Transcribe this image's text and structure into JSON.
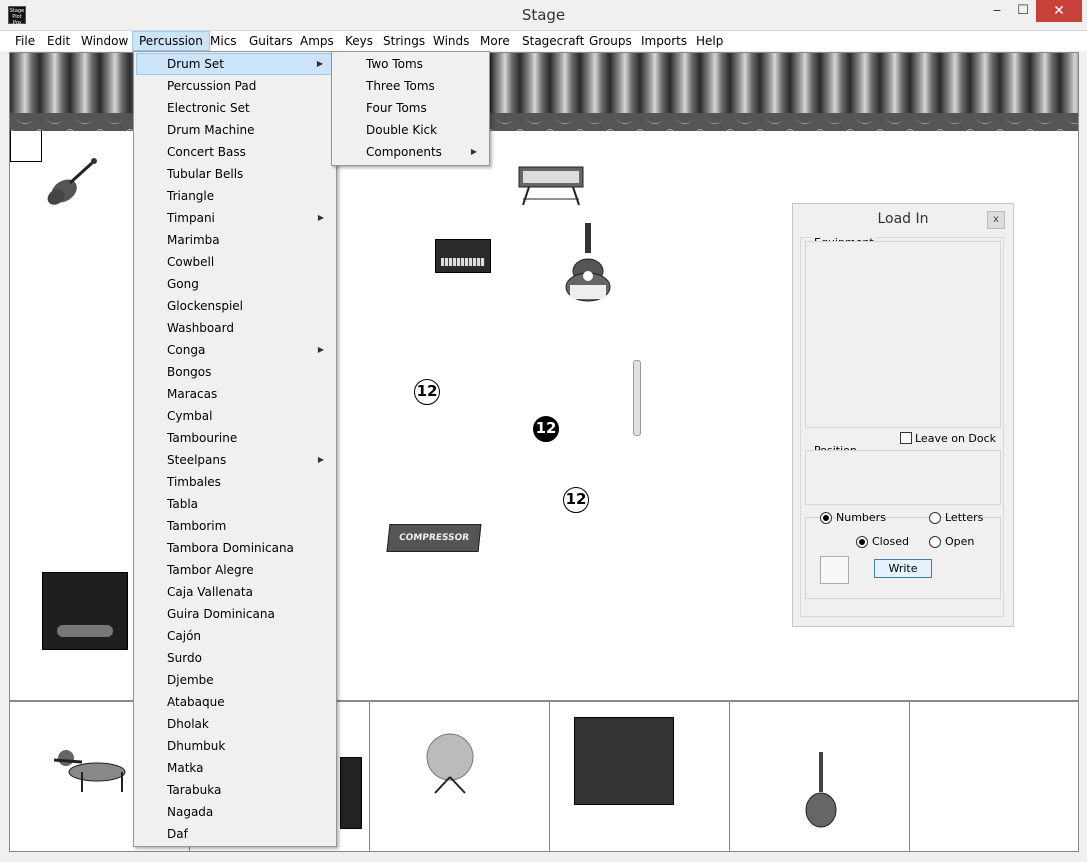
{
  "window": {
    "title": "Stage",
    "icon_text": "Stage Plot Pro",
    "minimize": "‒",
    "maximize": "☐",
    "close": "✕"
  },
  "menubar": [
    "File",
    "Edit",
    "Window",
    "Percussion",
    "Mics",
    "Guitars",
    "Amps",
    "Keys",
    "Strings",
    "Winds",
    "More",
    "Stagecraft",
    "Groups",
    "Imports",
    "Help"
  ],
  "percussion_menu": [
    {
      "label": "Drum Set",
      "submenu": true
    },
    {
      "label": "Percussion Pad"
    },
    {
      "label": "Electronic Set"
    },
    {
      "label": "Drum Machine"
    },
    {
      "label": "Concert Bass"
    },
    {
      "label": "Tubular Bells"
    },
    {
      "label": "Triangle"
    },
    {
      "label": "Timpani",
      "submenu": true
    },
    {
      "label": "Marimba"
    },
    {
      "label": "Cowbell"
    },
    {
      "label": "Gong"
    },
    {
      "label": "Glockenspiel"
    },
    {
      "label": "Washboard"
    },
    {
      "label": "Conga",
      "submenu": true
    },
    {
      "label": "Bongos"
    },
    {
      "label": "Maracas"
    },
    {
      "label": "Cymbal"
    },
    {
      "label": "Tambourine"
    },
    {
      "label": "Steelpans",
      "submenu": true
    },
    {
      "label": "Timbales"
    },
    {
      "label": "Tabla"
    },
    {
      "label": "Tamborim"
    },
    {
      "label": "Tambora Dominicana"
    },
    {
      "label": "Tambor Alegre"
    },
    {
      "label": "Caja Vallenata"
    },
    {
      "label": "Guira Dominicana"
    },
    {
      "label": "Cajón"
    },
    {
      "label": "Surdo"
    },
    {
      "label": "Djembe"
    },
    {
      "label": "Atabaque"
    },
    {
      "label": "Dholak"
    },
    {
      "label": "Dhumbuk"
    },
    {
      "label": "Matka"
    },
    {
      "label": "Tarabuka"
    },
    {
      "label": "Nagada"
    },
    {
      "label": "Daf"
    }
  ],
  "drumset_submenu": [
    {
      "label": "Two Toms"
    },
    {
      "label": "Three Toms"
    },
    {
      "label": "Four Toms"
    },
    {
      "label": "Double Kick"
    },
    {
      "label": "Components",
      "submenu": true
    }
  ],
  "submenu_arrow": "▶",
  "stage": {
    "number_markers": [
      "12",
      "12",
      "12"
    ],
    "compressor_label": "COMPRESSOR"
  },
  "load_in": {
    "title": "Load In",
    "close": "x",
    "equipment_label": "Equipment",
    "leave_on_dock_label": "Leave on Dock",
    "leave_on_dock_checked": false,
    "position_label": "Position",
    "numbers_label": "Numbers",
    "letters_label": "Letters",
    "closed_label": "Closed",
    "open_label": "Open",
    "write_label": "Write",
    "selected_style": "Numbers",
    "selected_shape": "Closed"
  }
}
